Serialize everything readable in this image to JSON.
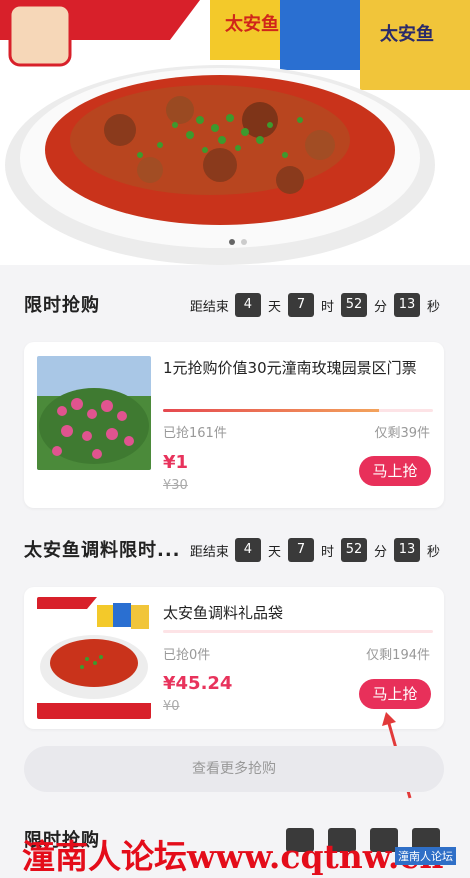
{
  "sections": [
    {
      "title": "限时抢购",
      "countdown": {
        "label": "距结束",
        "d": "4",
        "d_unit": "天",
        "h": "7",
        "h_unit": "时",
        "m": "52",
        "m_unit": "分",
        "s": "13",
        "s_unit": "秒"
      }
    },
    {
      "title": "太安鱼调料限时...",
      "countdown": {
        "label": "距结束",
        "d": "4",
        "d_unit": "天",
        "h": "7",
        "h_unit": "时",
        "m": "52",
        "m_unit": "分",
        "s": "13",
        "s_unit": "秒"
      }
    },
    {
      "title": "限时抢购"
    }
  ],
  "products": [
    {
      "title": "1元抢购价值30元潼南玫瑰园景区门票",
      "sold": "已抢161件",
      "remaining": "仅剩39件",
      "price": "¥1",
      "original_price": "¥30",
      "button": "马上抢",
      "progress": 0.8
    },
    {
      "title": "太安鱼调料礼品袋",
      "sold": "已抢0件",
      "remaining": "仅剩194件",
      "price": "¥45.24",
      "original_price": "¥0",
      "button": "马上抢",
      "progress": 0.0
    }
  ],
  "more_button": "查看更多抢购",
  "watermark": {
    "text": "潼南人论坛www.cqtnw.cn",
    "tag": "潼南人论坛"
  },
  "colors": {
    "accent": "#e8305a",
    "countdown_box": "#3a3a3a",
    "watermark": "#e40d1a"
  }
}
